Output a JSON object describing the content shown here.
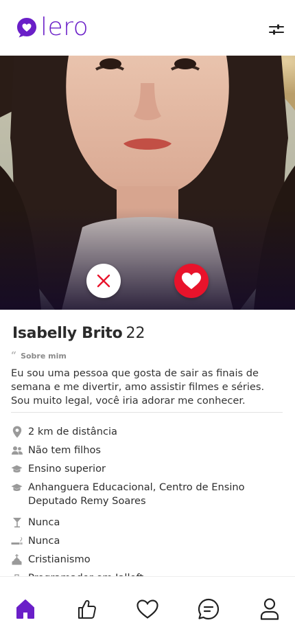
{
  "header": {
    "logo_text": "lero",
    "filter_icon": "sliders-icon"
  },
  "profile": {
    "name": "Isabelly Brito",
    "age": "22",
    "about_label": "Sobre mim",
    "about_icon": "quote-icon",
    "bio": "Eu sou uma pessoa que gosta de sair as finais de semana e me divertir, amo assistir filmes e séries. Sou muito legal, você iria adorar me conhecer."
  },
  "actions": {
    "dislike_icon": "close-icon",
    "like_icon": "heart-icon"
  },
  "info": [
    {
      "icon": "location-pin-icon",
      "text": "2 km de distância"
    },
    {
      "icon": "people-icon",
      "text": "Não tem filhos"
    },
    {
      "icon": "graduation-cap-icon",
      "text": "Ensino superior"
    },
    {
      "icon": "graduation-cap-icon",
      "text": "Anhanguera Educacional, Centro de Ensino Deputado Remy Soares"
    },
    {
      "icon": "drink-icon",
      "text": "Nunca"
    },
    {
      "icon": "smoking-icon",
      "text": "Nunca"
    },
    {
      "icon": "church-icon",
      "text": "Cristianismo"
    },
    {
      "icon": "briefcase-icon",
      "text": "Programador em Jalloft"
    }
  ],
  "nav": [
    {
      "icon": "home-icon",
      "active": true
    },
    {
      "icon": "thumbs-up-icon",
      "active": false
    },
    {
      "icon": "heart-outline-icon",
      "active": false
    },
    {
      "icon": "chat-icon",
      "active": false
    },
    {
      "icon": "profile-icon",
      "active": false
    }
  ],
  "colors": {
    "brand": "#6a1fc8",
    "like": "#e8132b",
    "dislike": "#e8132b"
  }
}
